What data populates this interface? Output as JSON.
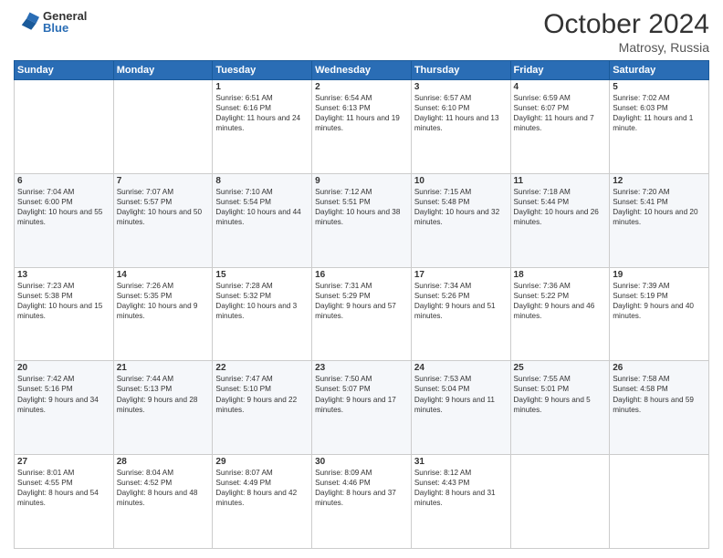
{
  "header": {
    "logo_general": "General",
    "logo_blue": "Blue",
    "month_title": "October 2024",
    "location": "Matrosy, Russia"
  },
  "days_of_week": [
    "Sunday",
    "Monday",
    "Tuesday",
    "Wednesday",
    "Thursday",
    "Friday",
    "Saturday"
  ],
  "weeks": [
    [
      {
        "num": "",
        "sunrise": "",
        "sunset": "",
        "daylight": ""
      },
      {
        "num": "",
        "sunrise": "",
        "sunset": "",
        "daylight": ""
      },
      {
        "num": "1",
        "sunrise": "Sunrise: 6:51 AM",
        "sunset": "Sunset: 6:16 PM",
        "daylight": "Daylight: 11 hours and 24 minutes."
      },
      {
        "num": "2",
        "sunrise": "Sunrise: 6:54 AM",
        "sunset": "Sunset: 6:13 PM",
        "daylight": "Daylight: 11 hours and 19 minutes."
      },
      {
        "num": "3",
        "sunrise": "Sunrise: 6:57 AM",
        "sunset": "Sunset: 6:10 PM",
        "daylight": "Daylight: 11 hours and 13 minutes."
      },
      {
        "num": "4",
        "sunrise": "Sunrise: 6:59 AM",
        "sunset": "Sunset: 6:07 PM",
        "daylight": "Daylight: 11 hours and 7 minutes."
      },
      {
        "num": "5",
        "sunrise": "Sunrise: 7:02 AM",
        "sunset": "Sunset: 6:03 PM",
        "daylight": "Daylight: 11 hours and 1 minute."
      }
    ],
    [
      {
        "num": "6",
        "sunrise": "Sunrise: 7:04 AM",
        "sunset": "Sunset: 6:00 PM",
        "daylight": "Daylight: 10 hours and 55 minutes."
      },
      {
        "num": "7",
        "sunrise": "Sunrise: 7:07 AM",
        "sunset": "Sunset: 5:57 PM",
        "daylight": "Daylight: 10 hours and 50 minutes."
      },
      {
        "num": "8",
        "sunrise": "Sunrise: 7:10 AM",
        "sunset": "Sunset: 5:54 PM",
        "daylight": "Daylight: 10 hours and 44 minutes."
      },
      {
        "num": "9",
        "sunrise": "Sunrise: 7:12 AM",
        "sunset": "Sunset: 5:51 PM",
        "daylight": "Daylight: 10 hours and 38 minutes."
      },
      {
        "num": "10",
        "sunrise": "Sunrise: 7:15 AM",
        "sunset": "Sunset: 5:48 PM",
        "daylight": "Daylight: 10 hours and 32 minutes."
      },
      {
        "num": "11",
        "sunrise": "Sunrise: 7:18 AM",
        "sunset": "Sunset: 5:44 PM",
        "daylight": "Daylight: 10 hours and 26 minutes."
      },
      {
        "num": "12",
        "sunrise": "Sunrise: 7:20 AM",
        "sunset": "Sunset: 5:41 PM",
        "daylight": "Daylight: 10 hours and 20 minutes."
      }
    ],
    [
      {
        "num": "13",
        "sunrise": "Sunrise: 7:23 AM",
        "sunset": "Sunset: 5:38 PM",
        "daylight": "Daylight: 10 hours and 15 minutes."
      },
      {
        "num": "14",
        "sunrise": "Sunrise: 7:26 AM",
        "sunset": "Sunset: 5:35 PM",
        "daylight": "Daylight: 10 hours and 9 minutes."
      },
      {
        "num": "15",
        "sunrise": "Sunrise: 7:28 AM",
        "sunset": "Sunset: 5:32 PM",
        "daylight": "Daylight: 10 hours and 3 minutes."
      },
      {
        "num": "16",
        "sunrise": "Sunrise: 7:31 AM",
        "sunset": "Sunset: 5:29 PM",
        "daylight": "Daylight: 9 hours and 57 minutes."
      },
      {
        "num": "17",
        "sunrise": "Sunrise: 7:34 AM",
        "sunset": "Sunset: 5:26 PM",
        "daylight": "Daylight: 9 hours and 51 minutes."
      },
      {
        "num": "18",
        "sunrise": "Sunrise: 7:36 AM",
        "sunset": "Sunset: 5:22 PM",
        "daylight": "Daylight: 9 hours and 46 minutes."
      },
      {
        "num": "19",
        "sunrise": "Sunrise: 7:39 AM",
        "sunset": "Sunset: 5:19 PM",
        "daylight": "Daylight: 9 hours and 40 minutes."
      }
    ],
    [
      {
        "num": "20",
        "sunrise": "Sunrise: 7:42 AM",
        "sunset": "Sunset: 5:16 PM",
        "daylight": "Daylight: 9 hours and 34 minutes."
      },
      {
        "num": "21",
        "sunrise": "Sunrise: 7:44 AM",
        "sunset": "Sunset: 5:13 PM",
        "daylight": "Daylight: 9 hours and 28 minutes."
      },
      {
        "num": "22",
        "sunrise": "Sunrise: 7:47 AM",
        "sunset": "Sunset: 5:10 PM",
        "daylight": "Daylight: 9 hours and 22 minutes."
      },
      {
        "num": "23",
        "sunrise": "Sunrise: 7:50 AM",
        "sunset": "Sunset: 5:07 PM",
        "daylight": "Daylight: 9 hours and 17 minutes."
      },
      {
        "num": "24",
        "sunrise": "Sunrise: 7:53 AM",
        "sunset": "Sunset: 5:04 PM",
        "daylight": "Daylight: 9 hours and 11 minutes."
      },
      {
        "num": "25",
        "sunrise": "Sunrise: 7:55 AM",
        "sunset": "Sunset: 5:01 PM",
        "daylight": "Daylight: 9 hours and 5 minutes."
      },
      {
        "num": "26",
        "sunrise": "Sunrise: 7:58 AM",
        "sunset": "Sunset: 4:58 PM",
        "daylight": "Daylight: 8 hours and 59 minutes."
      }
    ],
    [
      {
        "num": "27",
        "sunrise": "Sunrise: 8:01 AM",
        "sunset": "Sunset: 4:55 PM",
        "daylight": "Daylight: 8 hours and 54 minutes."
      },
      {
        "num": "28",
        "sunrise": "Sunrise: 8:04 AM",
        "sunset": "Sunset: 4:52 PM",
        "daylight": "Daylight: 8 hours and 48 minutes."
      },
      {
        "num": "29",
        "sunrise": "Sunrise: 8:07 AM",
        "sunset": "Sunset: 4:49 PM",
        "daylight": "Daylight: 8 hours and 42 minutes."
      },
      {
        "num": "30",
        "sunrise": "Sunrise: 8:09 AM",
        "sunset": "Sunset: 4:46 PM",
        "daylight": "Daylight: 8 hours and 37 minutes."
      },
      {
        "num": "31",
        "sunrise": "Sunrise: 8:12 AM",
        "sunset": "Sunset: 4:43 PM",
        "daylight": "Daylight: 8 hours and 31 minutes."
      },
      {
        "num": "",
        "sunrise": "",
        "sunset": "",
        "daylight": ""
      },
      {
        "num": "",
        "sunrise": "",
        "sunset": "",
        "daylight": ""
      }
    ]
  ]
}
